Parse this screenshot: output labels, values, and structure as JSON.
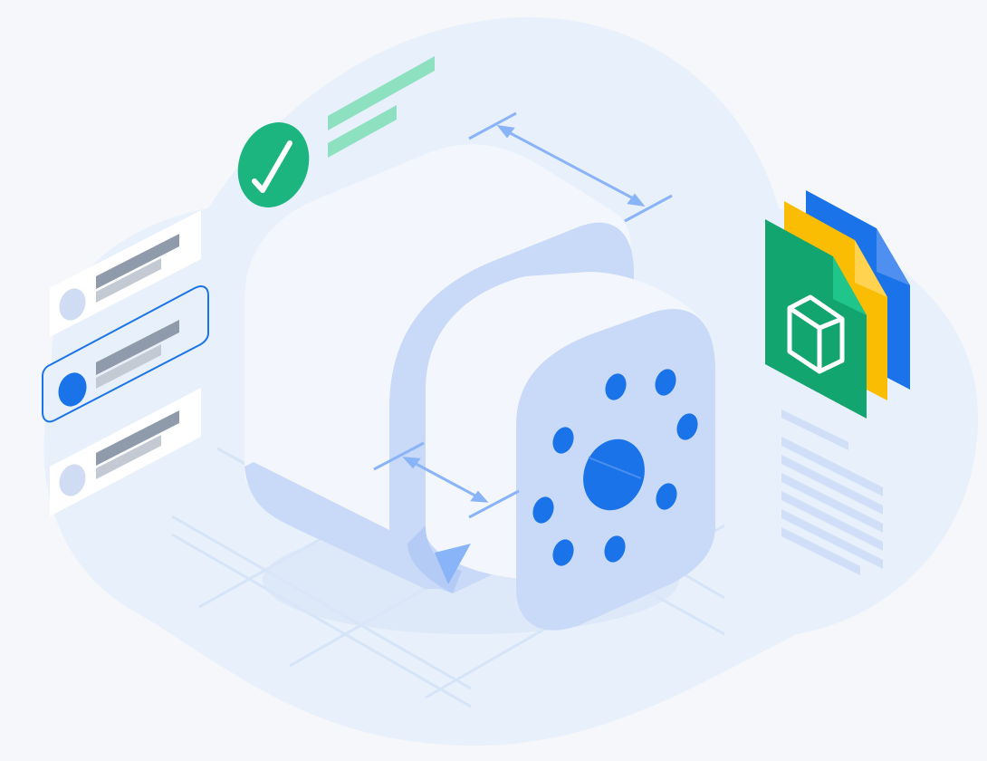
{
  "scene": {
    "description_visible_text": "",
    "palette": {
      "background": "#f5f7fa",
      "blob": "#e8f0fb",
      "grid": "#d6e4f7",
      "part_light": "#f3f7fd",
      "part_mid": "#c9daf8",
      "part_side": "#b4ccf5",
      "hole": "#1a73e8",
      "dimension": "#8ab4f8",
      "check_green": "#1db57f",
      "check_lines": "#8de0c0",
      "card_white": "#ffffff",
      "card_avatar": "#cfdcf3",
      "card_selected_border": "#1a73e8",
      "card_text_dark": "#8f9bab",
      "card_text_light": "#c3cad4",
      "file_green": "#13a56f",
      "file_yellow": "#fbbc04",
      "file_blue": "#1a73e8",
      "doc_lines": "#d0dff7"
    },
    "icons": {
      "check": "check-icon",
      "cube_file": "cube-file-icon",
      "flange_part": "flange-part-icon"
    },
    "list_cards": {
      "count": 3,
      "selected_index": 1
    },
    "files_stack": {
      "count": 3
    }
  }
}
